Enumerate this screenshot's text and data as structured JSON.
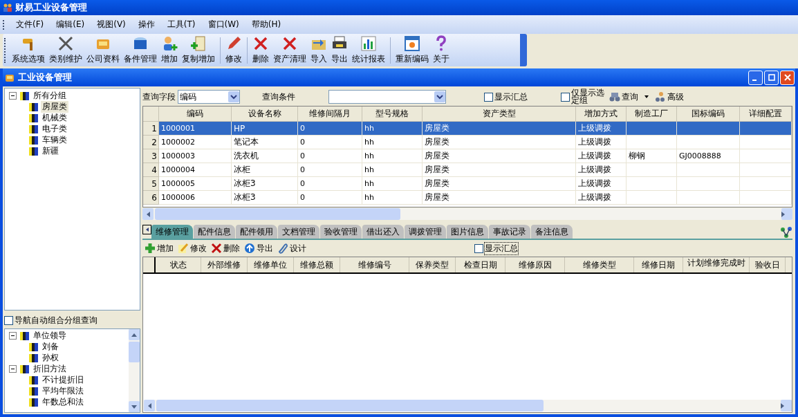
{
  "app": {
    "title": "财易工业设备管理"
  },
  "menu": [
    "文件(F)",
    "编辑(E)",
    "视图(V)",
    "操作",
    "工具(T)",
    "窗口(W)",
    "帮助(H)"
  ],
  "toolbar": [
    "系统选项",
    "类别维护",
    "公司资料",
    "备件管理",
    "增加",
    "复制增加",
    "修改",
    "删除",
    "资产清理",
    "导入",
    "导出",
    "统计报表",
    "重新编码",
    "关于"
  ],
  "window": {
    "title": "工业设备管理"
  },
  "group_tree": [
    {
      "label": "所有分组",
      "expanded": true,
      "selected": false,
      "children": [
        {
          "label": "房屋类",
          "selected": true
        },
        {
          "label": "机械类",
          "selected": false
        },
        {
          "label": "电子类",
          "selected": false
        },
        {
          "label": "车辆类",
          "selected": false
        },
        {
          "label": "新疆",
          "selected": false
        }
      ]
    }
  ],
  "nav_option": {
    "label": "导航自动组合分组查询",
    "checked": false
  },
  "nav_tree": [
    {
      "label": "单位领导",
      "expanded": true,
      "selected": false,
      "children": [
        {
          "label": "刘备",
          "selected": false
        },
        {
          "label": "孙权",
          "selected": false
        }
      ]
    },
    {
      "label": "折旧方法",
      "expanded": true,
      "selected": false,
      "children": [
        {
          "label": "不计提折旧",
          "selected": false
        },
        {
          "label": "平均年限法",
          "selected": false
        },
        {
          "label": "年数总和法",
          "selected": false
        }
      ]
    }
  ],
  "query": {
    "field_label": "查询字段",
    "field_value": "编码",
    "condition_label": "查询条件",
    "show_summary": {
      "label": "显示汇总",
      "checked": false
    },
    "selected_only": {
      "label": "仅显示选定组",
      "checked": false
    },
    "search_button": "查询",
    "advanced_button": "高级"
  },
  "table": {
    "columns": [
      "编码",
      "设备名称",
      "维修间隔月",
      "型号规格",
      "资产类型",
      "增加方式",
      "制造工厂",
      "国标编码",
      "详细配置"
    ],
    "rows": [
      {
        "num": "1",
        "selected": true,
        "cells": [
          "1000001",
          "HP",
          "0",
          "hh",
          "房屋类",
          "上级调拨"
        ]
      },
      {
        "num": "2",
        "selected": false,
        "cells": [
          "1000002",
          "笔记本",
          "0",
          "hh",
          "房屋类",
          "上级调拨"
        ]
      },
      {
        "num": "3",
        "selected": false,
        "cells": [
          "1000003",
          "洗衣机",
          "0",
          "hh",
          "房屋类",
          "上级调拨",
          "柳钢",
          "GJ0008888"
        ]
      },
      {
        "num": "4",
        "selected": false,
        "cells": [
          "1000004",
          "冰柜",
          "0",
          "hh",
          "房屋类",
          "上级调拨"
        ]
      },
      {
        "num": "5",
        "selected": false,
        "cells": [
          "1000005",
          "冰柜3",
          "0",
          "hh",
          "房屋类",
          "上级调拨"
        ]
      },
      {
        "num": "6",
        "selected": false,
        "cells": [
          "1000006",
          "冰柜3",
          "0",
          "hh",
          "房屋类",
          "上级调拨"
        ]
      }
    ]
  },
  "detail_tabs": [
    {
      "label": "维修管理",
      "selected": true
    },
    {
      "label": "配件信息",
      "selected": false
    },
    {
      "label": "配件领用",
      "selected": false
    },
    {
      "label": "文档管理",
      "selected": false
    },
    {
      "label": "验收管理",
      "selected": false
    },
    {
      "label": "借出还入",
      "selected": false
    },
    {
      "label": "调拨管理",
      "selected": false
    },
    {
      "label": "图片信息",
      "selected": false
    },
    {
      "label": "事故记录",
      "selected": false
    },
    {
      "label": "备注信息",
      "selected": false
    }
  ],
  "detail_toolbar": [
    "增加",
    "修改",
    "删除",
    "导出",
    "设计"
  ],
  "detail_summary": {
    "label": "显示汇总",
    "checked": false
  },
  "detail_table": {
    "columns": [
      "状态",
      "外部维修",
      "维修单位",
      "维修总额",
      "维修编号",
      "保养类型",
      "检查日期",
      "维修原因",
      "维修类型",
      "维修日期",
      "计划维修完成时",
      "验收日"
    ]
  }
}
